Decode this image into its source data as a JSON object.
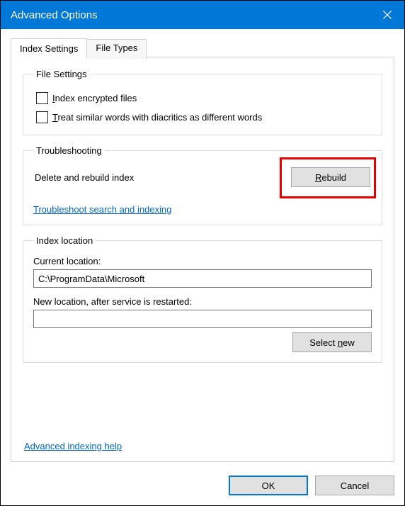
{
  "title": "Advanced Options",
  "tabs": {
    "index_settings": "Index Settings",
    "file_types": "File Types"
  },
  "file_settings": {
    "legend": "File Settings",
    "encrypt_prefix": "I",
    "encrypt_rest": "ndex encrypted files",
    "diacritics_prefix": "T",
    "diacritics_rest": "reat similar words with diacritics as different words"
  },
  "troubleshooting": {
    "legend": "Troubleshooting",
    "delete_label": "Delete and rebuild index",
    "rebuild_prefix": "R",
    "rebuild_rest": "ebuild",
    "troubleshoot_link": "Troubleshoot search and indexing"
  },
  "index_location": {
    "legend": "Index location",
    "current_label": "Current location:",
    "current_path": "C:\\ProgramData\\Microsoft",
    "new_label": "New location, after service is restarted:",
    "new_path": "",
    "select_pre": "Select ",
    "select_u": "n",
    "select_post": "ew"
  },
  "help_link": "Advanced indexing help",
  "buttons": {
    "ok": "OK",
    "cancel": "Cancel"
  }
}
